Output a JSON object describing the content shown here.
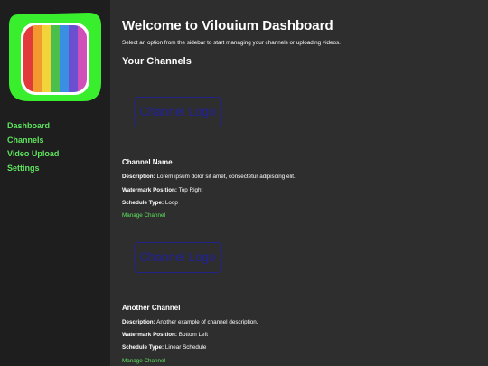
{
  "sidebar": {
    "logo_icon": "rainbow-tv-icon",
    "items": [
      {
        "label": "Dashboard"
      },
      {
        "label": "Channels"
      },
      {
        "label": "Video Upload"
      },
      {
        "label": "Settings"
      }
    ]
  },
  "main": {
    "title": "Welcome to Vilouium Dashboard",
    "subtitle": "Select an option from the sidebar to start managing your channels or uploading videos.",
    "section_title": "Your Channels",
    "channels": [
      {
        "logo_alt": "Channel Logo",
        "name": "Channel Name",
        "description_label": "Description:",
        "description": "Lorem ipsum dolor sit amet, consectetur adipiscing elit.",
        "watermark_label": "Watermark Position:",
        "watermark": "Top Right",
        "schedule_label": "Schedule Type:",
        "schedule": "Loop",
        "manage_label": "Manage Channel"
      },
      {
        "logo_alt": "Channel Logo",
        "name": "Another Channel",
        "description_label": "Description:",
        "description": "Another example of channel description.",
        "watermark_label": "Watermark Position:",
        "watermark": "Bottom Left",
        "schedule_label": "Schedule Type:",
        "schedule": "Linear Schedule",
        "manage_label": "Manage Channel"
      }
    ]
  },
  "colors": {
    "sidebar_bg": "#1e1e1e",
    "main_bg": "#2e2e2e",
    "accent_green": "#5fe35f",
    "logo_placeholder_blue": "#22229a"
  }
}
